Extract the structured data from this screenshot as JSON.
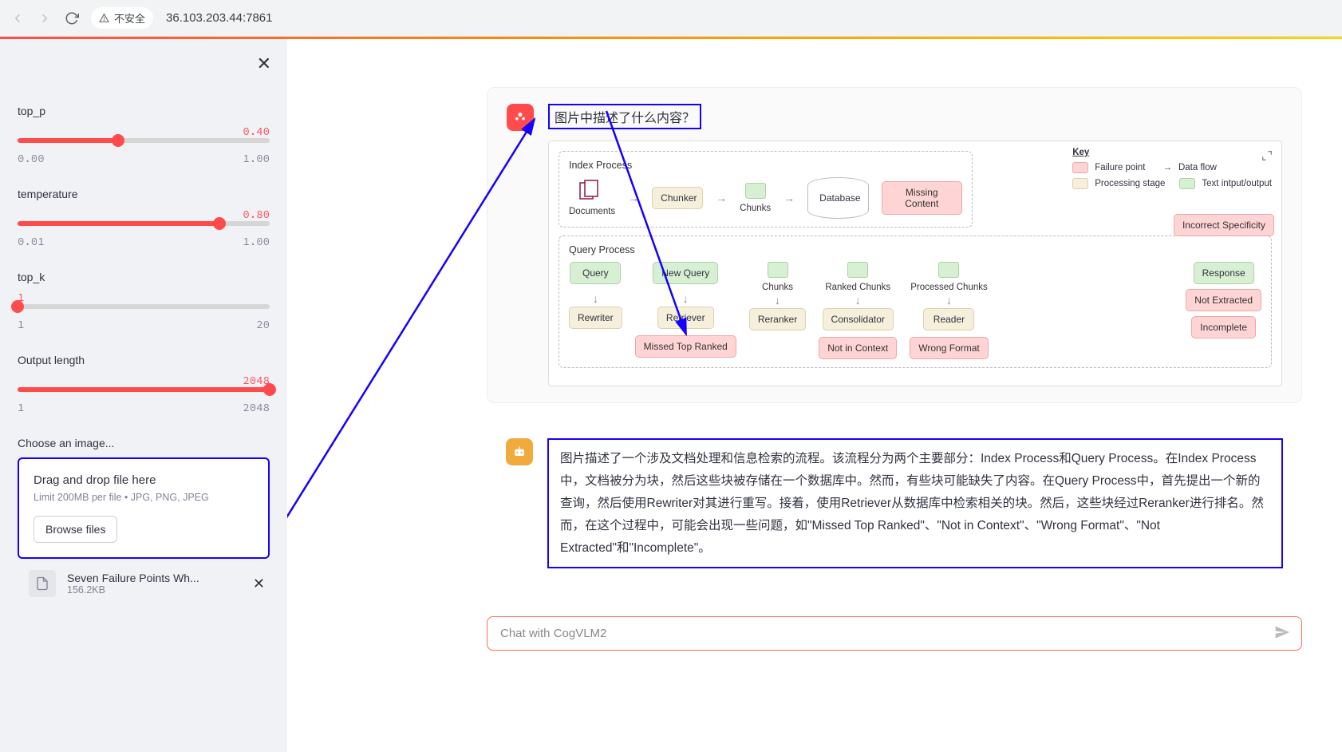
{
  "browser": {
    "security_label": "不安全",
    "url": "36.103.203.44:7861"
  },
  "sidebar": {
    "sliders": [
      {
        "label": "top_p",
        "value": "0.40",
        "min": "0.00",
        "max": "1.00",
        "fill_pct": 40,
        "val_align": "right"
      },
      {
        "label": "temperature",
        "value": "0.80",
        "min": "0.01",
        "max": "1.00",
        "fill_pct": 80,
        "val_align": "right"
      },
      {
        "label": "top_k",
        "value": "1",
        "min": "1",
        "max": "20",
        "fill_pct": 0,
        "val_align": "left"
      },
      {
        "label": "Output length",
        "value": "2048",
        "min": "1",
        "max": "2048",
        "fill_pct": 100,
        "val_align": "right"
      }
    ],
    "file_picker": {
      "label": "Choose an image...",
      "drop_text": "Drag and drop file here",
      "hint": "Limit 200MB per file • JPG, PNG, JPEG",
      "browse_label": "Browse files"
    },
    "uploaded": {
      "name": "Seven Failure Points Wh...",
      "size": "156.2KB"
    }
  },
  "chat": {
    "user_question": "图片中描述了什么内容？",
    "bot_response": "图片描述了一个涉及文档处理和信息检索的流程。该流程分为两个主要部分：Index Process和Query Process。在Index Process中，文档被分为块，然后这些块被存储在一个数据库中。然而，有些块可能缺失了内容。在Query Process中，首先提出一个新的查询，然后使用Rewriter对其进行重写。接着，使用Retriever从数据库中检索相关的块。然后，这些块经过Reranker进行排名。然而，在这个过程中，可能会出现一些问题，如\"Missed Top Ranked\"、\"Not in Context\"、\"Wrong Format\"、\"Not Extracted\"和\"Incomplete\"。",
    "input_placeholder": "Chat with CogVLM2"
  },
  "diagram": {
    "index_title": "Index Process",
    "query_title": "Query Process",
    "key_title": "Key",
    "key": {
      "failure": "Failure point",
      "stage": "Processing stage",
      "flow": "Data flow",
      "text": "Text intput/output"
    },
    "index": {
      "documents": "Documents",
      "chunker": "Chunker",
      "chunks": "Chunks",
      "database": "Database",
      "missing": "Missing Content"
    },
    "query": {
      "query": "Query",
      "newq": "New Query",
      "chunks": "Chunks",
      "ranked": "Ranked Chunks",
      "processed": "Processed Chunks",
      "response": "Response",
      "rewriter": "Rewriter",
      "retriever": "Retriever",
      "reranker": "Reranker",
      "consolidator": "Consolidator",
      "reader": "Reader"
    },
    "fails": {
      "incorrect_spec": "Incorrect Specificity",
      "missed_top": "Missed Top Ranked",
      "not_ctx": "Not in Context",
      "wrong_fmt": "Wrong Format",
      "not_ext": "Not Extracted",
      "incomplete": "Incomplete"
    }
  }
}
